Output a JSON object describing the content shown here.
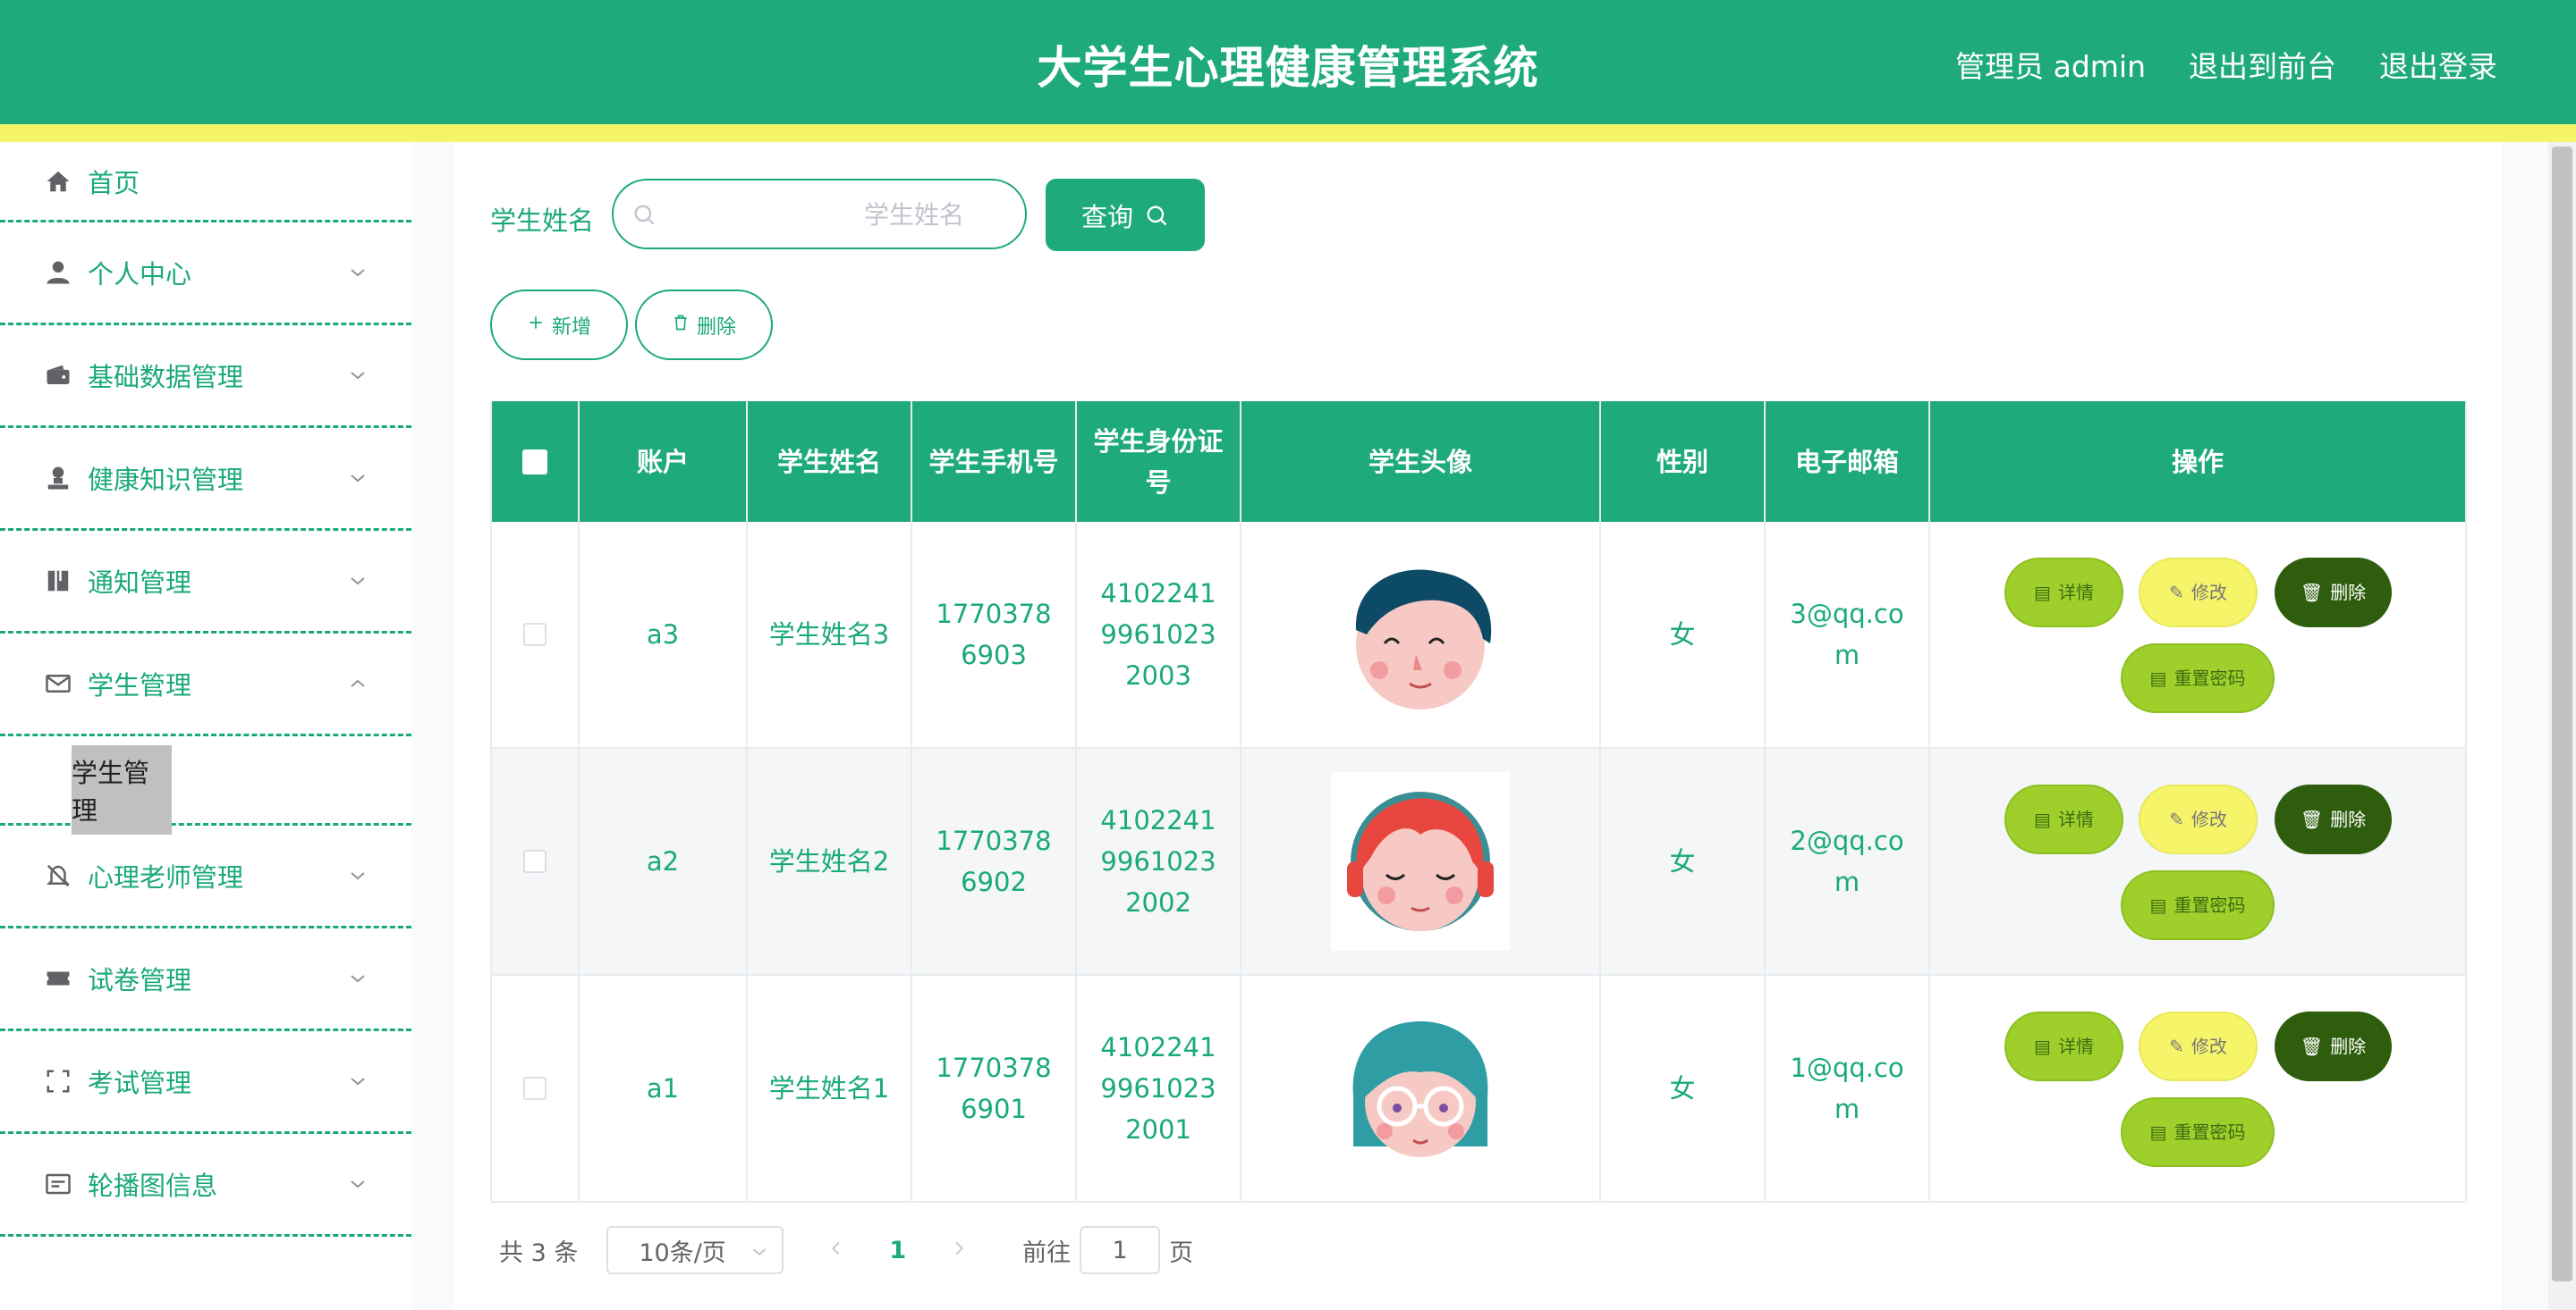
{
  "header": {
    "title": "大学生心理健康管理系统",
    "admin_label": "管理员 admin",
    "back_to_front": "退出到前台",
    "logout": "退出登录"
  },
  "sidebar": {
    "items": [
      {
        "label": "首页",
        "icon": "home-icon"
      },
      {
        "label": "个人中心",
        "icon": "user-icon"
      },
      {
        "label": "基础数据管理",
        "icon": "wallet-icon"
      },
      {
        "label": "健康知识管理",
        "icon": "person-stamp-icon"
      },
      {
        "label": "通知管理",
        "icon": "book-icon"
      },
      {
        "label": "学生管理",
        "icon": "mail-icon"
      },
      {
        "label": "心理老师管理",
        "icon": "bell-off-icon"
      },
      {
        "label": "试卷管理",
        "icon": "ticket-icon"
      },
      {
        "label": "考试管理",
        "icon": "fullscreen-icon"
      },
      {
        "label": "轮播图信息",
        "icon": "message-box-icon"
      }
    ],
    "submenu": {
      "label": "学生管理"
    }
  },
  "search": {
    "label": "学生姓名",
    "placeholder": "学生姓名",
    "query_label": "查询"
  },
  "actions": {
    "add_label": "新增",
    "delete_label": "删除"
  },
  "table": {
    "headers": [
      "账户",
      "学生姓名",
      "学生手机号",
      "学生身份证号",
      "学生头像",
      "性别",
      "电子邮箱",
      "操作"
    ],
    "rows": [
      {
        "account": "a3",
        "name": "学生姓名3",
        "phone": "17703786903",
        "id_card": "410224199610232003",
        "avatar": "boy-avatar",
        "gender": "女",
        "email": "3@qq.com"
      },
      {
        "account": "a2",
        "name": "学生姓名2",
        "phone": "17703786902",
        "id_card": "410224199610232002",
        "avatar": "red-hair-girl-avatar",
        "gender": "女",
        "email": "2@qq.com"
      },
      {
        "account": "a1",
        "name": "学生姓名1",
        "phone": "17703786901",
        "id_card": "410224199610232001",
        "avatar": "teal-hair-glasses-avatar",
        "gender": "女",
        "email": "1@qq.com"
      }
    ],
    "op_labels": {
      "detail": "详情",
      "edit": "修改",
      "delete": "删除",
      "reset": "重置密码"
    }
  },
  "pagination": {
    "total": "共 3 条",
    "page_size": "10条/页",
    "current_page": "1",
    "goto_label": "前往",
    "goto_value": "1",
    "page_unit": "页"
  },
  "colors": {
    "primary": "#1fab79",
    "accent_yellow": "#f6f56a",
    "lime": "#9fcf2b",
    "dark_green": "#2e5e0d"
  }
}
